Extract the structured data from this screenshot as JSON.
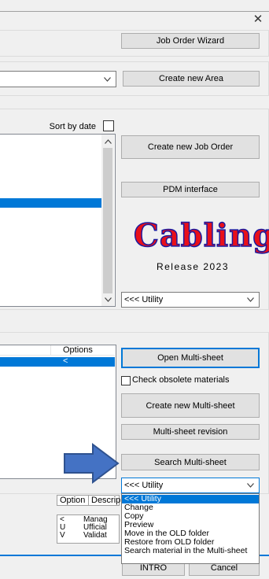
{
  "window": {
    "close_glyph": "✕"
  },
  "top": {
    "job_order_wizard": "Job Order Wizard"
  },
  "area": {
    "create_new_area": "Create new Area"
  },
  "job_orders": {
    "sort_by_date_label": "Sort by date",
    "create_new_job_order": "Create new Job Order",
    "pdm_interface": "PDM interface",
    "utility_select": "<<< Utility"
  },
  "logo": {
    "text": "Cabling",
    "release": "Release 2023"
  },
  "multisheet": {
    "header_options": "Options",
    "selected_row_value": "<",
    "open_multisheet": "Open Multi-sheet",
    "check_obsolete": "Check obsolete materials",
    "create_new_multisheet": "Create new Multi-sheet",
    "multisheet_revision": "Multi-sheet revision",
    "search_multisheet": "Search Multi-sheet",
    "utility_select": "<<< Utility",
    "utility_options": [
      "<<< Utility",
      "Change",
      "Copy",
      "Preview",
      "Move in the OLD folder",
      "Restore from OLD folder",
      "Search material in the Multi-sheet"
    ]
  },
  "legend": {
    "headers": [
      "Option",
      "Descrip"
    ],
    "rows": [
      {
        "code": "<",
        "desc": "Manag"
      },
      {
        "code": "U",
        "desc": "Ufficial"
      },
      {
        "code": "V",
        "desc": "Validat"
      }
    ]
  },
  "bottom": {
    "intro": "INTRO",
    "cancel": "Cancel"
  },
  "colors": {
    "accent": "#0078d7",
    "arrow": "#4472c4",
    "logo_fill": "#e8101a",
    "logo_outline": "#1a1aa0"
  }
}
